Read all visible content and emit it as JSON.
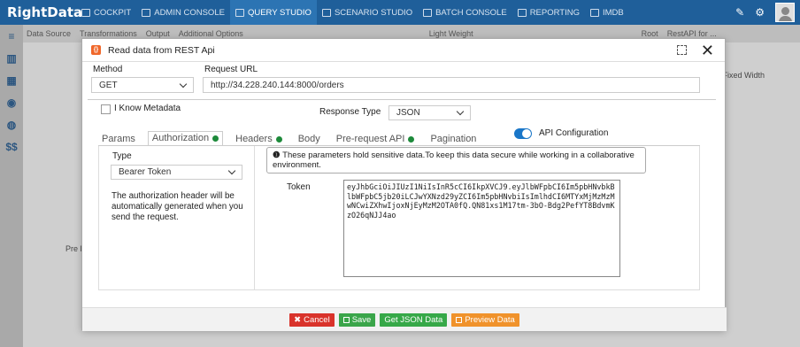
{
  "app": {
    "logo": "RightData"
  },
  "nav": [
    {
      "label": "COCKPIT",
      "icon": "grid-icon"
    },
    {
      "label": "ADMIN CONSOLE",
      "icon": "settings-icon"
    },
    {
      "label": "QUERY STUDIO",
      "icon": "database-icon",
      "active": true
    },
    {
      "label": "SCENARIO STUDIO",
      "icon": "flow-icon"
    },
    {
      "label": "BATCH CONSOLE",
      "icon": "batch-icon"
    },
    {
      "label": "REPORTING",
      "icon": "report-icon"
    },
    {
      "label": "IMDB",
      "icon": "table-icon"
    }
  ],
  "toolbar": {
    "data_source": "Data Source",
    "transformations": "Transformations",
    "output": "Output",
    "additional_options": "Additional Options",
    "light_weight": "Light Weight",
    "root": "Root",
    "restapi": "RestAPI for ..."
  },
  "background": {
    "pre_label": "Pre F",
    "fixed_width": "Fixed Width"
  },
  "modal": {
    "title": "Read data from REST Api",
    "method_label": "Method",
    "method_value": "GET",
    "url_label": "Request URL",
    "url_value": "http://34.228.240.144:8000/orders",
    "know_metadata": "I Know Metadata",
    "response_type_label": "Response Type",
    "response_type_value": "JSON",
    "tabs": [
      "Params",
      "Authorization",
      "Headers",
      "Body",
      "Pre-request API",
      "Pagination"
    ],
    "api_config": "API Configuration",
    "auth": {
      "type_label": "Type",
      "type_value": "Bearer Token",
      "help": "The authorization header will be automatically generated when you send the request.",
      "notice": "These parameters hold sensitive data.To keep this data secure while working in a collaborative environment.",
      "token_label": "Token",
      "token_value": "eyJhbGciOiJIUzI1NiIsInR5cCI6IkpXVCJ9.eyJlbWFpbCI6Im5pbHNvbkBlbWFpbC5jb20iLCJwYXNzd29yZCI6Im5pbHNvbiIsImlhdCI6MTYxMjMzMzMwNCwiZXhwIjoxNjEyMzM2OTA0fQ.QN81xs1M17tm-3bO-Bdg2PefYT8BdvmKzO26qNJJ4ao"
    },
    "buttons": {
      "cancel": "Cancel",
      "save": "Save",
      "get_json": "Get JSON Data",
      "preview": "Preview Data"
    }
  }
}
